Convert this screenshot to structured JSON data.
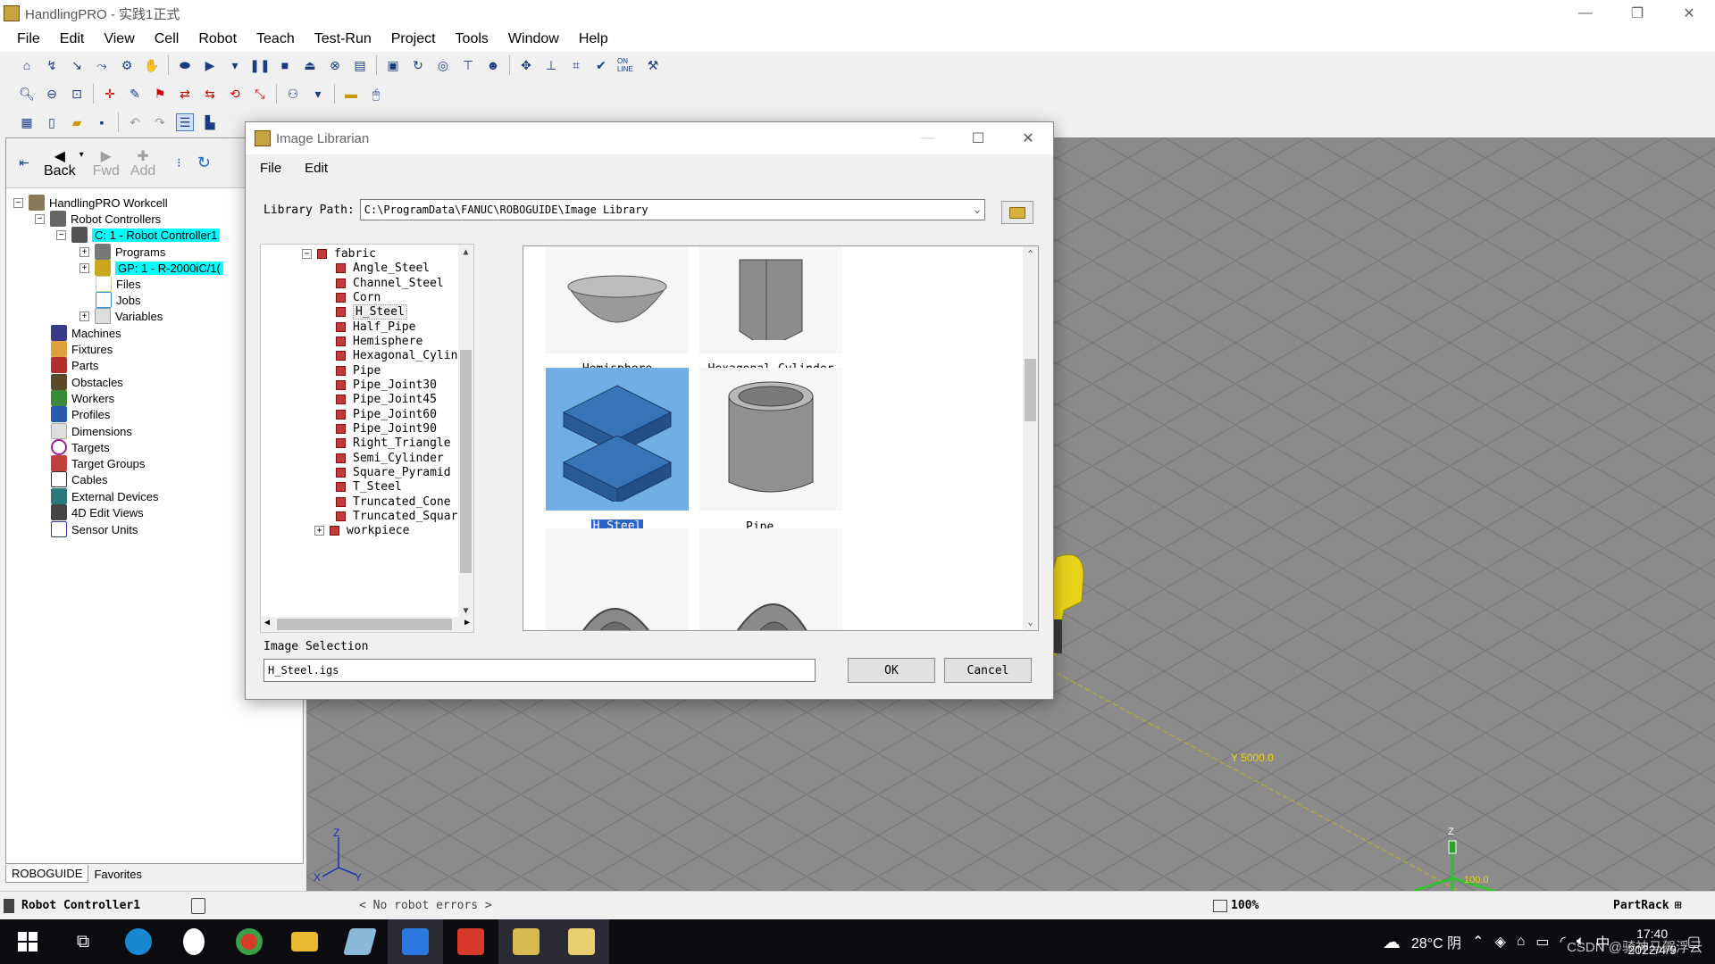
{
  "window": {
    "title": "HandlingPRO - 实践1正式",
    "minimize": "—",
    "restore": "❐",
    "close": "✕"
  },
  "menu": [
    "File",
    "Edit",
    "View",
    "Cell",
    "Robot",
    "Teach",
    "Test-Run",
    "Project",
    "Tools",
    "Window",
    "Help"
  ],
  "toolbar_online_label": "ON LINE",
  "nav": {
    "back": "Back",
    "fwd": "Fwd",
    "add": "Add"
  },
  "tree": {
    "root": "HandlingPRO Workcell",
    "robot_controllers": "Robot Controllers",
    "controller": "C: 1 - Robot Controller1",
    "programs": "Programs",
    "gp": "GP: 1 - R-2000iC/1(",
    "files": "Files",
    "jobs": "Jobs",
    "variables": "Variables",
    "machines": "Machines",
    "fixtures": "Fixtures",
    "parts": "Parts",
    "obstacles": "Obstacles",
    "workers": "Workers",
    "profiles": "Profiles",
    "dimensions": "Dimensions",
    "targets": "Targets",
    "target_groups": "Target Groups",
    "cables": "Cables",
    "external_devices": "External Devices",
    "edit_views": "4D Edit Views",
    "sensor_units": "Sensor Units"
  },
  "left_tabs": [
    "ROBOGUIDE",
    "Favorites"
  ],
  "dialog": {
    "title": "Image Librarian",
    "menu": [
      "File",
      "Edit"
    ],
    "library_path_label": "Library Path:",
    "library_path": "C:\\ProgramData\\FANUC\\ROBOGUIDE\\Image Library",
    "folder": "fabric",
    "items": [
      "Angle_Steel",
      "Channel_Steel",
      "Corn",
      "H_Steel",
      "Half_Pipe",
      "Hemisphere",
      "Hexagonal_Cylinder",
      "Pipe",
      "Pipe_Joint30",
      "Pipe_Joint45",
      "Pipe_Joint60",
      "Pipe_Joint90",
      "Right_Triangle",
      "Semi_Cylinder",
      "Square_Pyramid",
      "T_Steel",
      "Truncated_Cone",
      "Truncated_Square_Py"
    ],
    "folder2": "workpiece",
    "gallery": {
      "hemisphere": "Hemisphere",
      "hexagonal_cylinder": "Hexagonal_Cylinder",
      "h_steel": "H_Steel",
      "pipe": "Pipe"
    },
    "image_selection_label": "Image Selection",
    "image_selection_value": "H_Steel.igs",
    "ok": "OK",
    "cancel": "Cancel"
  },
  "viewport": {
    "y_label": "Y 5000.0",
    "axis_z": "Z",
    "axis_x": "X",
    "axis_y": "Y",
    "marker_label": "100.0",
    "marker_z": "Z"
  },
  "status": {
    "controller": "Robot Controller1",
    "errors": "< No robot errors >",
    "zoom": "100%",
    "part": "PartRack"
  },
  "taskbar": {
    "weather": "28°C 阴",
    "ime": "中",
    "time": "17:40",
    "date": "2022/4/9",
    "watermark": "CSDN @骑神马驾浮云"
  },
  "colors": {
    "highlight": "#00ffff",
    "viewport_bg": "#8b8b8b",
    "selection_blue": "#72aee6",
    "robot_yellow": "#e8d21a"
  }
}
